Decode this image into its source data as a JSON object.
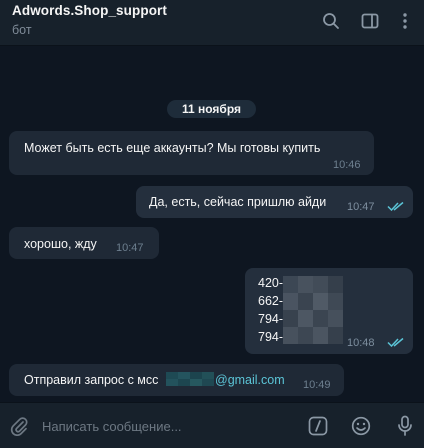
{
  "header": {
    "title": "Adwords.Shop_support",
    "subtitle": "бот",
    "icons": [
      "search-icon",
      "sidebar-toggle-icon",
      "more-vertical-icon"
    ]
  },
  "date_separator": "11 ноября",
  "messages": [
    {
      "direction": "in",
      "text": "Может быть есть еще аккаунты? Мы готовы купить",
      "time": "10:46"
    },
    {
      "direction": "out",
      "text": "Да, есть, сейчас пришлю айди",
      "time": "10:47",
      "status": "read"
    },
    {
      "direction": "in",
      "text": "хорошо, жду",
      "time": "10:47"
    },
    {
      "direction": "out",
      "lines": [
        "420-",
        "662-",
        "794-",
        "794-"
      ],
      "time": "10:48",
      "status": "read"
    },
    {
      "direction": "in",
      "text_prefix": "Отправил запрос с мсс",
      "link": "@gmail.com",
      "time": "10:49"
    }
  ],
  "composer": {
    "placeholder": "Написать сообщение...",
    "icons": [
      "attach-icon",
      "commands-icon",
      "emoji-icon",
      "microphone-icon"
    ]
  },
  "colors": {
    "background": "#0e1621",
    "header": "#17212b",
    "incoming_bubble": "#182533",
    "outgoing_bubble": "#2b5278",
    "link": "#5bc4d6",
    "read_ticks": "#5bc4d6"
  }
}
